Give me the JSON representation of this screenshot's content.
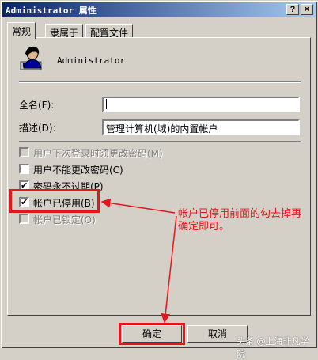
{
  "window": {
    "title": "Administrator 属性",
    "help_btn": "?",
    "close_btn": "×"
  },
  "tabs": [
    {
      "label": "常规"
    },
    {
      "label": "隶属于"
    },
    {
      "label": "配置文件"
    }
  ],
  "user": {
    "name": "Administrator"
  },
  "form": {
    "fullname_label": "全名(F):",
    "fullname_value": "",
    "desc_label": "描述(D):",
    "desc_value": "管理计算机(域)的内置帐户"
  },
  "checkboxes": [
    {
      "label": "用户下次登录时须更改密码(M)",
      "checked": false,
      "enabled": false
    },
    {
      "label": "用户不能更改密码(C)",
      "checked": false,
      "enabled": true
    },
    {
      "label": "密码永不过期(P)",
      "checked": true,
      "enabled": true
    },
    {
      "label": "帐户已停用(B)",
      "checked": true,
      "enabled": true
    },
    {
      "label": "帐户已锁定(O)",
      "checked": false,
      "enabled": false
    }
  ],
  "buttons": {
    "ok": "确定",
    "cancel": "取消"
  },
  "annotation": {
    "line1": "帐户已停用前面的勾去掉再",
    "line2": "确定即可。"
  },
  "watermark": "头条 @上海非凡学院",
  "colors": {
    "annotation": "#e8141b",
    "title_bar": "#0a246a"
  }
}
